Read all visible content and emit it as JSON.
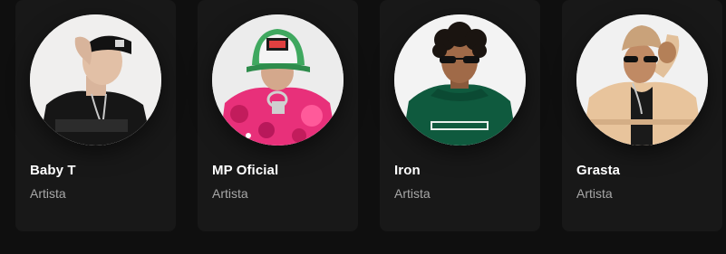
{
  "artists": [
    {
      "name": "Baby T",
      "subtitle": "Artista",
      "avatar_icon": "artist-photo-icon"
    },
    {
      "name": "MP Oficial",
      "subtitle": "Artista",
      "avatar_icon": "artist-photo-icon"
    },
    {
      "name": "Iron",
      "subtitle": "Artista",
      "avatar_icon": "artist-photo-icon"
    },
    {
      "name": "Grasta",
      "subtitle": "Artista",
      "avatar_icon": "artist-photo-icon"
    }
  ],
  "colors": {
    "background": "#0f0f0f",
    "card": "#181818",
    "title": "#ffffff",
    "subtitle": "#a7a7a7"
  }
}
